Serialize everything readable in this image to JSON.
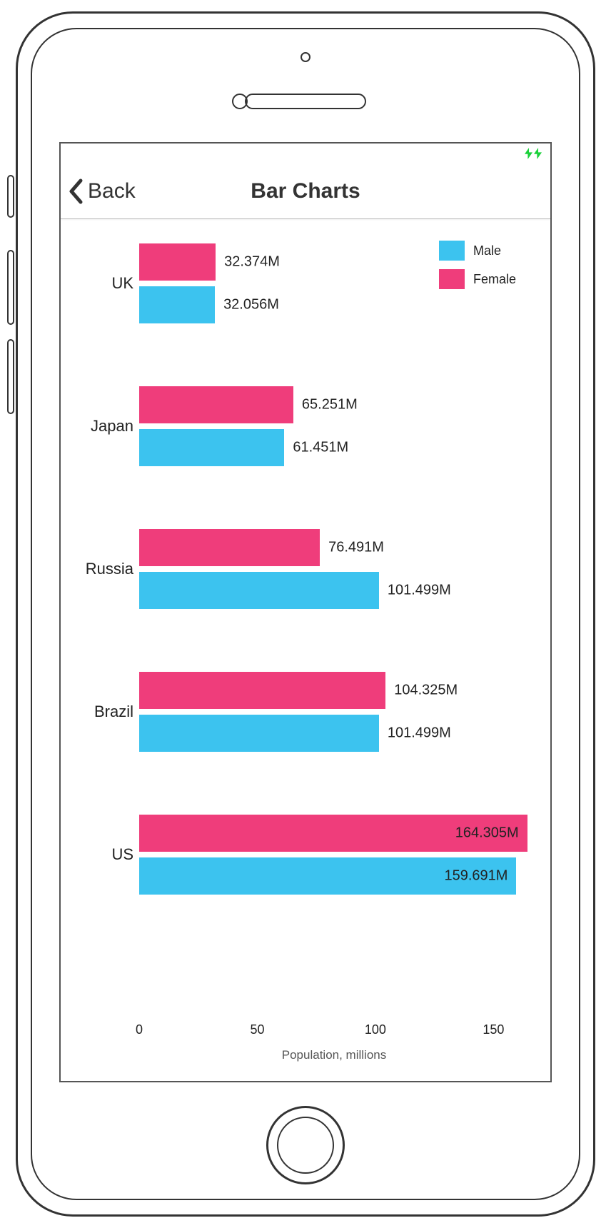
{
  "nav": {
    "back_label": "Back",
    "title": "Bar Charts"
  },
  "legend": {
    "male": "Male",
    "female": "Female"
  },
  "colors": {
    "male": "#3cc3ef",
    "female": "#ef3d7b"
  },
  "chart_data": {
    "type": "bar",
    "orientation": "horizontal",
    "grouped": true,
    "categories": [
      "UK",
      "Japan",
      "Russia",
      "Brazil",
      "US"
    ],
    "series": [
      {
        "name": "Female",
        "color": "#ef3d7b",
        "values": [
          32.374,
          65.251,
          76.491,
          104.325,
          164.305
        ]
      },
      {
        "name": "Male",
        "color": "#3cc3ef",
        "values": [
          32.056,
          61.451,
          101.499,
          101.499,
          159.691
        ]
      }
    ],
    "value_labels": {
      "Female": [
        "32.374M",
        "65.251M",
        "76.491M",
        "104.325M",
        "164.305M"
      ],
      "Male": [
        "32.056M",
        "61.451M",
        "101.499M",
        "101.499M",
        "159.691M"
      ]
    },
    "xlabel": "Population, millions",
    "ylabel": "",
    "xlim": [
      0,
      165
    ],
    "x_ticks": [
      0,
      50,
      100,
      150
    ],
    "legend_position": "top-right"
  }
}
